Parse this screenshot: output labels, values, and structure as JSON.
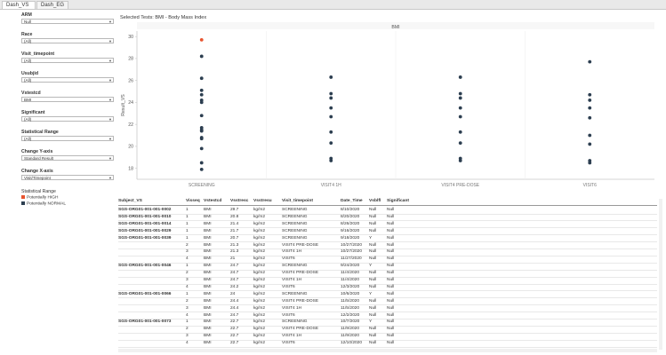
{
  "tabs": [
    {
      "label": "Dash_VS",
      "active": true
    },
    {
      "label": "Dash_EG",
      "active": false
    }
  ],
  "filters": [
    {
      "label": "ARM",
      "value": "Null"
    },
    {
      "label": "Race",
      "value": "(All)"
    },
    {
      "label": "Visit_timepoint",
      "value": "(All)"
    },
    {
      "label": "Usubjid",
      "value": "(All)"
    },
    {
      "label": "Vstestcd",
      "value": "BMI"
    },
    {
      "label": "Significant",
      "value": "(All)"
    },
    {
      "label": "Statistical Range",
      "value": "(All)"
    },
    {
      "label": "Change Y-axis",
      "value": "Standard Result"
    },
    {
      "label": "Change X-axis",
      "value": "Visit/Timepoint"
    }
  ],
  "legend": {
    "title": "Statistical Range",
    "items": [
      {
        "label": "Potentially HIGH",
        "color": "#e8542f"
      },
      {
        "label": "Potentially NORMAL",
        "color": "#2c3e50"
      }
    ]
  },
  "chart_title": "Selected Tests: BMI - Body Mass Index",
  "chart_data": {
    "type": "scatter",
    "title": "BMI",
    "ylabel": "Result_VS",
    "xlabel": "",
    "ylim": [
      17,
      30.5
    ],
    "yticks": [
      18,
      20,
      22,
      24,
      26,
      28,
      30
    ],
    "categories": [
      "SCREENING",
      "VISIT4 1H",
      "VISIT4 PRE-DOSE",
      "VISIT6"
    ],
    "grid": false,
    "series": [
      {
        "name": "Potentially HIGH",
        "color": "#e8542f",
        "points": [
          {
            "x": "SCREENING",
            "y": 29.7
          }
        ]
      },
      {
        "name": "Potentially NORMAL",
        "color": "#2c3e50",
        "points": [
          {
            "x": "SCREENING",
            "y": 28.2
          },
          {
            "x": "SCREENING",
            "y": 26.2
          },
          {
            "x": "SCREENING",
            "y": 25.1
          },
          {
            "x": "SCREENING",
            "y": 24.7
          },
          {
            "x": "SCREENING",
            "y": 24.2
          },
          {
            "x": "SCREENING",
            "y": 24.0
          },
          {
            "x": "SCREENING",
            "y": 22.8
          },
          {
            "x": "SCREENING",
            "y": 21.7
          },
          {
            "x": "SCREENING",
            "y": 21.5
          },
          {
            "x": "SCREENING",
            "y": 21.4
          },
          {
            "x": "SCREENING",
            "y": 20.8
          },
          {
            "x": "SCREENING",
            "y": 20.7
          },
          {
            "x": "SCREENING",
            "y": 19.8
          },
          {
            "x": "SCREENING",
            "y": 18.5
          },
          {
            "x": "SCREENING",
            "y": 17.9
          },
          {
            "x": "VISIT4 1H",
            "y": 26.3
          },
          {
            "x": "VISIT4 1H",
            "y": 24.8
          },
          {
            "x": "VISIT4 1H",
            "y": 24.4
          },
          {
            "x": "VISIT4 1H",
            "y": 23.5
          },
          {
            "x": "VISIT4 1H",
            "y": 22.7
          },
          {
            "x": "VISIT4 1H",
            "y": 21.3
          },
          {
            "x": "VISIT4 1H",
            "y": 20.3
          },
          {
            "x": "VISIT4 1H",
            "y": 18.9
          },
          {
            "x": "VISIT4 1H",
            "y": 18.7
          },
          {
            "x": "VISIT4 PRE-DOSE",
            "y": 26.3
          },
          {
            "x": "VISIT4 PRE-DOSE",
            "y": 24.8
          },
          {
            "x": "VISIT4 PRE-DOSE",
            "y": 24.4
          },
          {
            "x": "VISIT4 PRE-DOSE",
            "y": 23.5
          },
          {
            "x": "VISIT4 PRE-DOSE",
            "y": 22.7
          },
          {
            "x": "VISIT4 PRE-DOSE",
            "y": 21.3
          },
          {
            "x": "VISIT4 PRE-DOSE",
            "y": 20.3
          },
          {
            "x": "VISIT4 PRE-DOSE",
            "y": 18.9
          },
          {
            "x": "VISIT4 PRE-DOSE",
            "y": 18.7
          },
          {
            "x": "VISIT6",
            "y": 27.7
          },
          {
            "x": "VISIT6",
            "y": 24.7
          },
          {
            "x": "VISIT6",
            "y": 24.2
          },
          {
            "x": "VISIT6",
            "y": 23.5
          },
          {
            "x": "VISIT6",
            "y": 22.6
          },
          {
            "x": "VISIT6",
            "y": 21.0
          },
          {
            "x": "VISIT6",
            "y": 20.2
          },
          {
            "x": "VISIT6",
            "y": 18.7
          },
          {
            "x": "VISIT6",
            "y": 18.5
          }
        ]
      }
    ]
  },
  "table": {
    "columns": [
      "Subject_VS",
      "Visseq",
      "Vstestcd",
      "Vsstresc",
      "Vsstresu",
      "Visit_timepoint",
      "Date_Time",
      "Vsblfl",
      "Significant"
    ],
    "rows": [
      [
        "SGS-ORG01-001-001-0002",
        "1",
        "BMI",
        "29.7",
        "kg/m2",
        "SCREENING",
        "8/10/2020",
        "Null",
        "Null"
      ],
      [
        "SGS-ORG01-001-001-0010",
        "1",
        "BMI",
        "20.8",
        "kg/m2",
        "SCREENING",
        "8/20/2020",
        "Null",
        "Null"
      ],
      [
        "SGS-ORG01-001-001-0014",
        "1",
        "BMI",
        "21.4",
        "kg/m2",
        "SCREENING",
        "8/26/2020",
        "Null",
        "Null"
      ],
      [
        "SGS-ORG01-001-001-0029",
        "1",
        "BMI",
        "21.7",
        "kg/m2",
        "SCREENING",
        "9/16/2020",
        "Null",
        "Null"
      ],
      [
        "SGS-ORG01-001-001-0039",
        "1",
        "BMI",
        "20.7",
        "kg/m2",
        "SCREENING",
        "9/18/2020",
        "Y",
        "Null"
      ],
      [
        "",
        "2",
        "BMI",
        "21.3",
        "kg/m2",
        "VISIT4 PRE-DOSE",
        "10/27/2020",
        "Null",
        "Null"
      ],
      [
        "",
        "3",
        "BMI",
        "21.3",
        "kg/m2",
        "VISIT4 1H",
        "10/27/2020",
        "Null",
        "Null"
      ],
      [
        "",
        "4",
        "BMI",
        "21",
        "kg/m2",
        "VISIT6",
        "11/27/2020",
        "Null",
        "Null"
      ],
      [
        "SGS-ORG01-001-001-0046",
        "1",
        "BMI",
        "24.7",
        "kg/m2",
        "SCREENING",
        "9/24/2020",
        "Y",
        "Null"
      ],
      [
        "",
        "2",
        "BMI",
        "24.7",
        "kg/m2",
        "VISIT4 PRE-DOSE",
        "11/4/2020",
        "Null",
        "Null"
      ],
      [
        "",
        "3",
        "BMI",
        "24.7",
        "kg/m2",
        "VISIT4 1H",
        "11/4/2020",
        "Null",
        "Null"
      ],
      [
        "",
        "4",
        "BMI",
        "24.2",
        "kg/m2",
        "VISIT6",
        "12/3/2020",
        "Null",
        "Null"
      ],
      [
        "SGS-ORG01-001-001-0066",
        "1",
        "BMI",
        "24",
        "kg/m2",
        "SCREENING",
        "10/6/2020",
        "Y",
        "Null"
      ],
      [
        "",
        "2",
        "BMI",
        "24.4",
        "kg/m2",
        "VISIT4 PRE-DOSE",
        "11/5/2020",
        "Null",
        "Null"
      ],
      [
        "",
        "3",
        "BMI",
        "24.4",
        "kg/m2",
        "VISIT4 1H",
        "11/5/2020",
        "Null",
        "Null"
      ],
      [
        "",
        "4",
        "BMI",
        "24.7",
        "kg/m2",
        "VISIT6",
        "12/2/2020",
        "Null",
        "Null"
      ],
      [
        "SGS-ORG01-001-001-0073",
        "1",
        "BMI",
        "22.7",
        "kg/m2",
        "SCREENING",
        "10/7/2020",
        "Y",
        "Null"
      ],
      [
        "",
        "2",
        "BMI",
        "22.7",
        "kg/m2",
        "VISIT4 PRE-DOSE",
        "11/9/2020",
        "Null",
        "Null"
      ],
      [
        "",
        "3",
        "BMI",
        "22.7",
        "kg/m2",
        "VISIT4 1H",
        "11/9/2020",
        "Null",
        "Null"
      ],
      [
        "",
        "4",
        "BMI",
        "22.7",
        "kg/m2",
        "VISIT6",
        "12/10/2020",
        "Null",
        "Null"
      ]
    ]
  }
}
